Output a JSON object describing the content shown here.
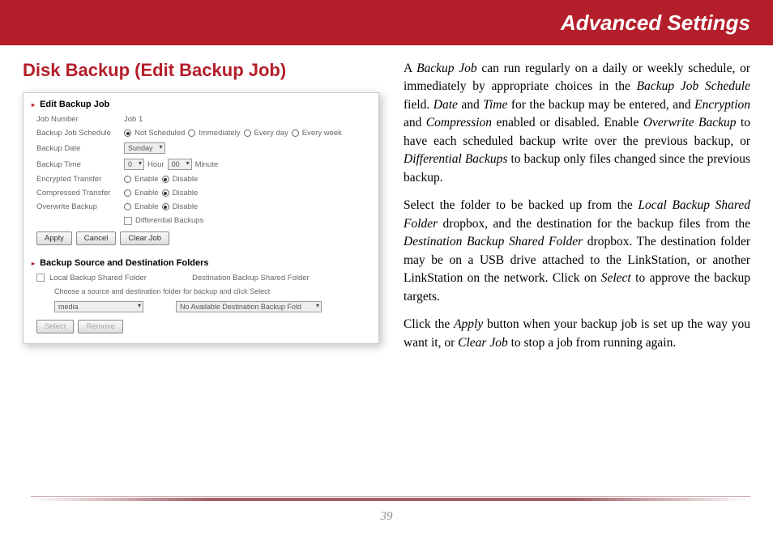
{
  "header": {
    "title": "Advanced Settings"
  },
  "page": {
    "title": "Disk Backup (Edit Backup Job)",
    "number": "39"
  },
  "panel1": {
    "heading": "Edit Backup Job",
    "rows": {
      "job_number": {
        "label": "Job Number",
        "value": "Job 1"
      },
      "schedule": {
        "label": "Backup Job Schedule",
        "options": [
          "Not Scheduled",
          "Immediately",
          "Every day",
          "Every week"
        ]
      },
      "date": {
        "label": "Backup Date",
        "value": "Sunday"
      },
      "time": {
        "label": "Backup Time",
        "hour": "0",
        "hour_label": "Hour",
        "minute": "00",
        "minute_label": "Minute"
      },
      "encrypted": {
        "label": "Encrypted Transfer",
        "enable": "Enable",
        "disable": "Disable"
      },
      "compressed": {
        "label": "Compressed Transfer",
        "enable": "Enable",
        "disable": "Disable"
      },
      "overwrite": {
        "label": "Overwrite Backup",
        "enable": "Enable",
        "disable": "Disable"
      },
      "differential": {
        "label": "Differential Backups"
      }
    },
    "buttons": {
      "apply": "Apply",
      "cancel": "Cancel",
      "clear": "Clear Job"
    }
  },
  "panel2": {
    "heading": "Backup Source and Destination Folders",
    "local_col": "Local Backup Shared Folder",
    "dest_col": "Destination Backup Shared Folder",
    "note": "Choose a source and destination folder for backup and click Select",
    "source_value": "media",
    "dest_value": "No Available Destination Backup Fold",
    "select_btn": "Select",
    "remove_btn": "Remove"
  },
  "body": {
    "p1a": "A ",
    "p1b": "Backup Job",
    "p1c": " can run regularly on a daily or weekly schedule, or immediately by appropriate choices in the ",
    "p1d": "Backup Job Schedule",
    "p1e": " field.  ",
    "p1f": "Date",
    "p1g": " and ",
    "p1h": "Time",
    "p1i": " for the backup may be entered, and ",
    "p1j": "Encryption",
    "p1k": " and ",
    "p1l": "Compression",
    "p1m": " enabled or disabled.  Enable ",
    "p1n": "Overwrite Backup",
    "p1o": " to have each scheduled backup write over the previous backup, or ",
    "p1p": "Differential Backups",
    "p1q": " to backup only files changed since the previous backup.",
    "p2a": "Select the folder to be backed up from the ",
    "p2b": "Local Backup Shared Folder",
    "p2c": " dropbox, and the destination for the backup files from the ",
    "p2d": "Destination Backup Shared Folder",
    "p2e": " dropbox.  The destination folder may be on a USB drive attached to the LinkStation, or another LinkStation on the network.  Click on ",
    "p2f": "Select",
    "p2g": " to approve the backup targets.",
    "p3a": "Click the ",
    "p3b": "Apply",
    "p3c": " button when your backup job is set up the way you want it, or ",
    "p3d": "Clear Job",
    "p3e": " to stop a job from running again."
  }
}
